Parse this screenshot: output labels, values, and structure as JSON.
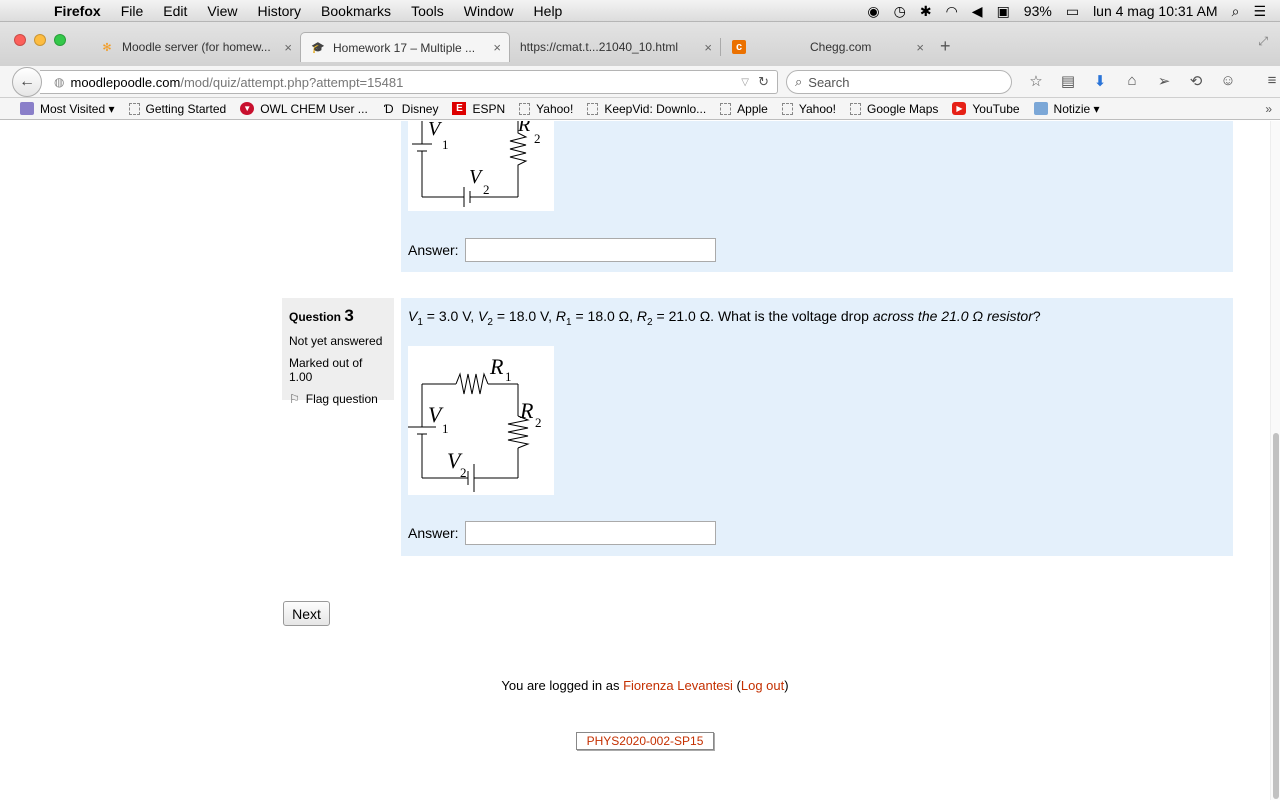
{
  "menubar": {
    "app": "Firefox",
    "items": [
      "File",
      "Edit",
      "View",
      "History",
      "Bookmarks",
      "Tools",
      "Window",
      "Help"
    ],
    "battery": "93%",
    "datetime": "lun 4 mag  10:31 AM"
  },
  "tabs": [
    {
      "title": "Moodle server (for homew...",
      "active": false
    },
    {
      "title": "Homework 17 – Multiple ...",
      "active": true
    },
    {
      "title": "https://cmat.t...21040_10.html",
      "active": false
    },
    {
      "title": "Chegg.com",
      "active": false
    }
  ],
  "nav": {
    "url_host": "moodlepoodle.com",
    "url_path": "/mod/quiz/attempt.php?attempt=15481",
    "search_placeholder": "Search"
  },
  "bookmarks": [
    {
      "label": "Most Visited ▾",
      "icon": "most-visited-icon"
    },
    {
      "label": "Getting Started",
      "icon": "page-icon"
    },
    {
      "label": "OWL CHEM User ...",
      "icon": "owl-icon"
    },
    {
      "label": "Disney",
      "icon": "disney-icon"
    },
    {
      "label": "ESPN",
      "icon": "espn-icon"
    },
    {
      "label": "Yahoo!",
      "icon": "page-icon"
    },
    {
      "label": "KeepVid: Downlo...",
      "icon": "page-icon"
    },
    {
      "label": "Apple",
      "icon": "page-icon"
    },
    {
      "label": "Yahoo!",
      "icon": "page-icon"
    },
    {
      "label": "Google Maps",
      "icon": "page-icon"
    },
    {
      "label": "YouTube",
      "icon": "youtube-icon"
    },
    {
      "label": "Notizie ▾",
      "icon": "folder-icon"
    }
  ],
  "question2": {
    "circuit_labels": {
      "v1": "V",
      "v1_sub": "1",
      "r2": "R",
      "r2_sub": "2",
      "v2": "V",
      "v2_sub": "2"
    },
    "answer_label": "Answer:",
    "answer_value": ""
  },
  "question3": {
    "heading_prefix": "Question",
    "number": "3",
    "status": "Not yet answered",
    "marks": "Marked out of 1.00",
    "flag_label": "Flag question",
    "text_v1": "V",
    "text_v1_sub": "1",
    "text_v1_val": " = 3.0 V, ",
    "text_v2": "V",
    "text_v2_sub": "2",
    "text_v2_val": " = 18.0 V, ",
    "text_r1": "R",
    "text_r1_sub": "1",
    "text_r1_val": " = 18.0 Ω, ",
    "text_r2": "R",
    "text_r2_sub": "2",
    "text_r2_val": " = 21.0 Ω. What is the voltage drop ",
    "text_emph": "across the 21.0 Ω resistor",
    "text_end": "?",
    "circuit_labels": {
      "r1": "R",
      "r1_sub": "1",
      "r2": "R",
      "r2_sub": "2",
      "v1": "V",
      "v1_sub": "1",
      "v2": "V",
      "v2_sub": "2"
    },
    "answer_label": "Answer:",
    "answer_value": ""
  },
  "next_label": "Next",
  "footer": {
    "logged_prefix": "You are logged in as ",
    "user": "Fiorenza Levantesi",
    "logout_open": " (",
    "logout": "Log out",
    "logout_close": ")",
    "course": "PHYS2020-002-SP15"
  }
}
